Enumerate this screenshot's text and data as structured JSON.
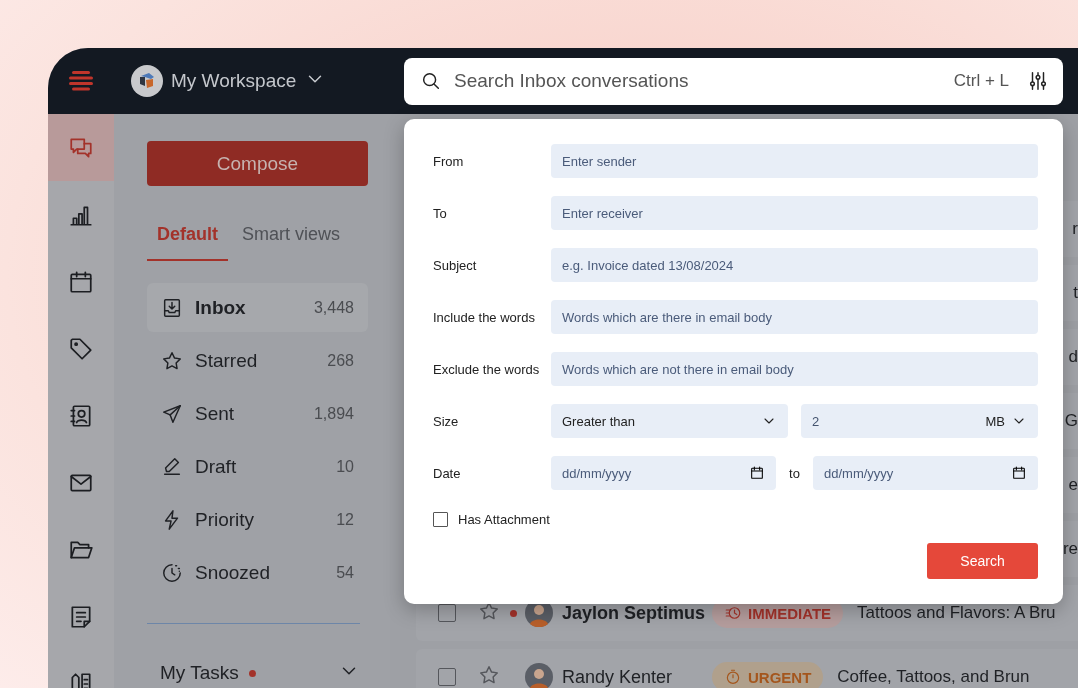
{
  "workspace": {
    "name": "My Workspace"
  },
  "search": {
    "placeholder": "Search Inbox conversations",
    "shortcut": "Ctrl + L"
  },
  "rail": [
    {
      "kind": "chat",
      "selected": true
    },
    {
      "kind": "chart",
      "selected": false
    },
    {
      "kind": "calendar",
      "selected": false
    },
    {
      "kind": "tag",
      "selected": false
    },
    {
      "kind": "contacts",
      "selected": false
    },
    {
      "kind": "mail",
      "selected": false
    },
    {
      "kind": "folder",
      "selected": false
    },
    {
      "kind": "note",
      "selected": false
    },
    {
      "kind": "book",
      "selected": false
    }
  ],
  "compose": "Compose",
  "tabs": [
    {
      "label": "Default",
      "selected": true
    },
    {
      "label": "Smart views",
      "selected": false
    }
  ],
  "folders": [
    {
      "kind": "inbox",
      "label": "Inbox",
      "count": "3,448",
      "selected": true
    },
    {
      "kind": "starred",
      "label": "Starred",
      "count": "268",
      "selected": false
    },
    {
      "kind": "sent",
      "label": "Sent",
      "count": "1,894",
      "selected": false
    },
    {
      "kind": "draft",
      "label": "Draft",
      "count": "10",
      "selected": false
    },
    {
      "kind": "priority",
      "label": "Priority",
      "count": "12",
      "selected": false
    },
    {
      "kind": "snoozed",
      "label": "Snoozed",
      "count": "54",
      "selected": false
    }
  ],
  "tasks": {
    "label": "My Tasks",
    "unread": true
  },
  "messages": [
    {
      "kind": "partial",
      "subject": "r"
    },
    {
      "kind": "partial",
      "subject": "t"
    },
    {
      "kind": "partial",
      "subject": "d"
    },
    {
      "kind": "partial",
      "subject": "G"
    },
    {
      "kind": "partial",
      "subject": "e"
    },
    {
      "kind": "partial",
      "subject": "re"
    },
    {
      "kind": "full",
      "checked": false,
      "unread": true,
      "name": "Jaylon Septimus",
      "tag": {
        "kind": "immediate",
        "label": "IMMEDIATE"
      },
      "subject": "Tattoos and Flavors: A Bru"
    },
    {
      "kind": "full",
      "checked": false,
      "unread": false,
      "name": "Randy Kenter",
      "tag": {
        "kind": "urgent",
        "label": "URGENT"
      },
      "subject": "Coffee, Tattoos, and Brun"
    }
  ],
  "search_panel": {
    "fields": [
      {
        "kind": "text",
        "label": "From",
        "placeholder": "Enter sender"
      },
      {
        "kind": "text",
        "label": "To",
        "placeholder": "Enter receiver"
      },
      {
        "kind": "text",
        "label": "Subject",
        "placeholder": "e.g. Invoice dated 13/08/2024"
      },
      {
        "kind": "text",
        "label": "Include the words",
        "placeholder": "Words which are there in email body"
      },
      {
        "kind": "text",
        "label": "Exclude the words",
        "placeholder": "Words which are not there in email body"
      },
      {
        "kind": "size",
        "label": "Size",
        "comparison": "Greater than",
        "value": "2",
        "unit": "MB"
      },
      {
        "kind": "date",
        "label": "Date",
        "from_placeholder": "dd/mm/yyyy",
        "separator": "to",
        "to_placeholder": "dd/mm/yyyy"
      }
    ],
    "attachment": {
      "label": "Has Attachment",
      "checked": false
    },
    "submit": "Search"
  }
}
